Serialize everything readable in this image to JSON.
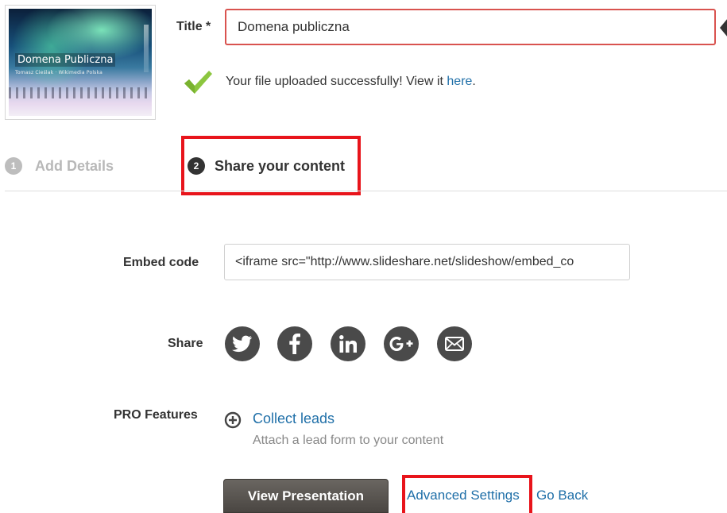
{
  "thumbnail": {
    "title": "Domena Publiczna",
    "subtitle": "Tomasz Cieślak · Wikimedia Polska"
  },
  "title_field": {
    "label": "Title *",
    "value": "Domena publiczna"
  },
  "upload": {
    "message": "Your file uploaded successfully! View it ",
    "link": "here",
    "end": "."
  },
  "steps": [
    {
      "number": "1",
      "label": "Add Details"
    },
    {
      "number": "2",
      "label": "Share your content"
    }
  ],
  "embed": {
    "label": "Embed code",
    "value": "<iframe src=\"http://www.slideshare.net/slideshow/embed_co"
  },
  "share": {
    "label": "Share",
    "icons": [
      "twitter-icon",
      "facebook-icon",
      "linkedin-icon",
      "google-plus-icon",
      "email-icon"
    ]
  },
  "pro": {
    "label": "PRO Features",
    "link": "Collect leads",
    "description": "Attach a lead form to your content"
  },
  "actions": {
    "view": "View Presentation",
    "advanced": "Advanced Settings",
    "back": "Go Back"
  },
  "colors": {
    "link": "#1f6fa8",
    "highlight": "#e8141b",
    "check": "#8cc63f",
    "icon": "#4a4a4a"
  }
}
